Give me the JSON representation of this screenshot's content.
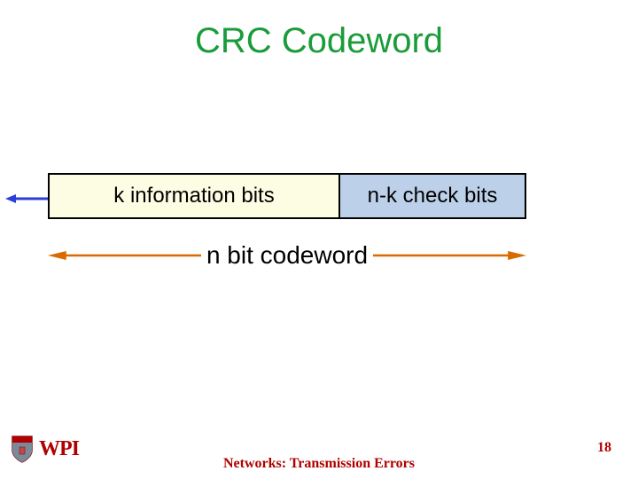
{
  "title": "CRC Codeword",
  "blocks": {
    "info": "k information bits",
    "check": "n-k check bits"
  },
  "codeword_label": "n bit codeword",
  "footer": {
    "center": "Networks: Transmission Errors",
    "page": "18",
    "org": "WPI"
  }
}
